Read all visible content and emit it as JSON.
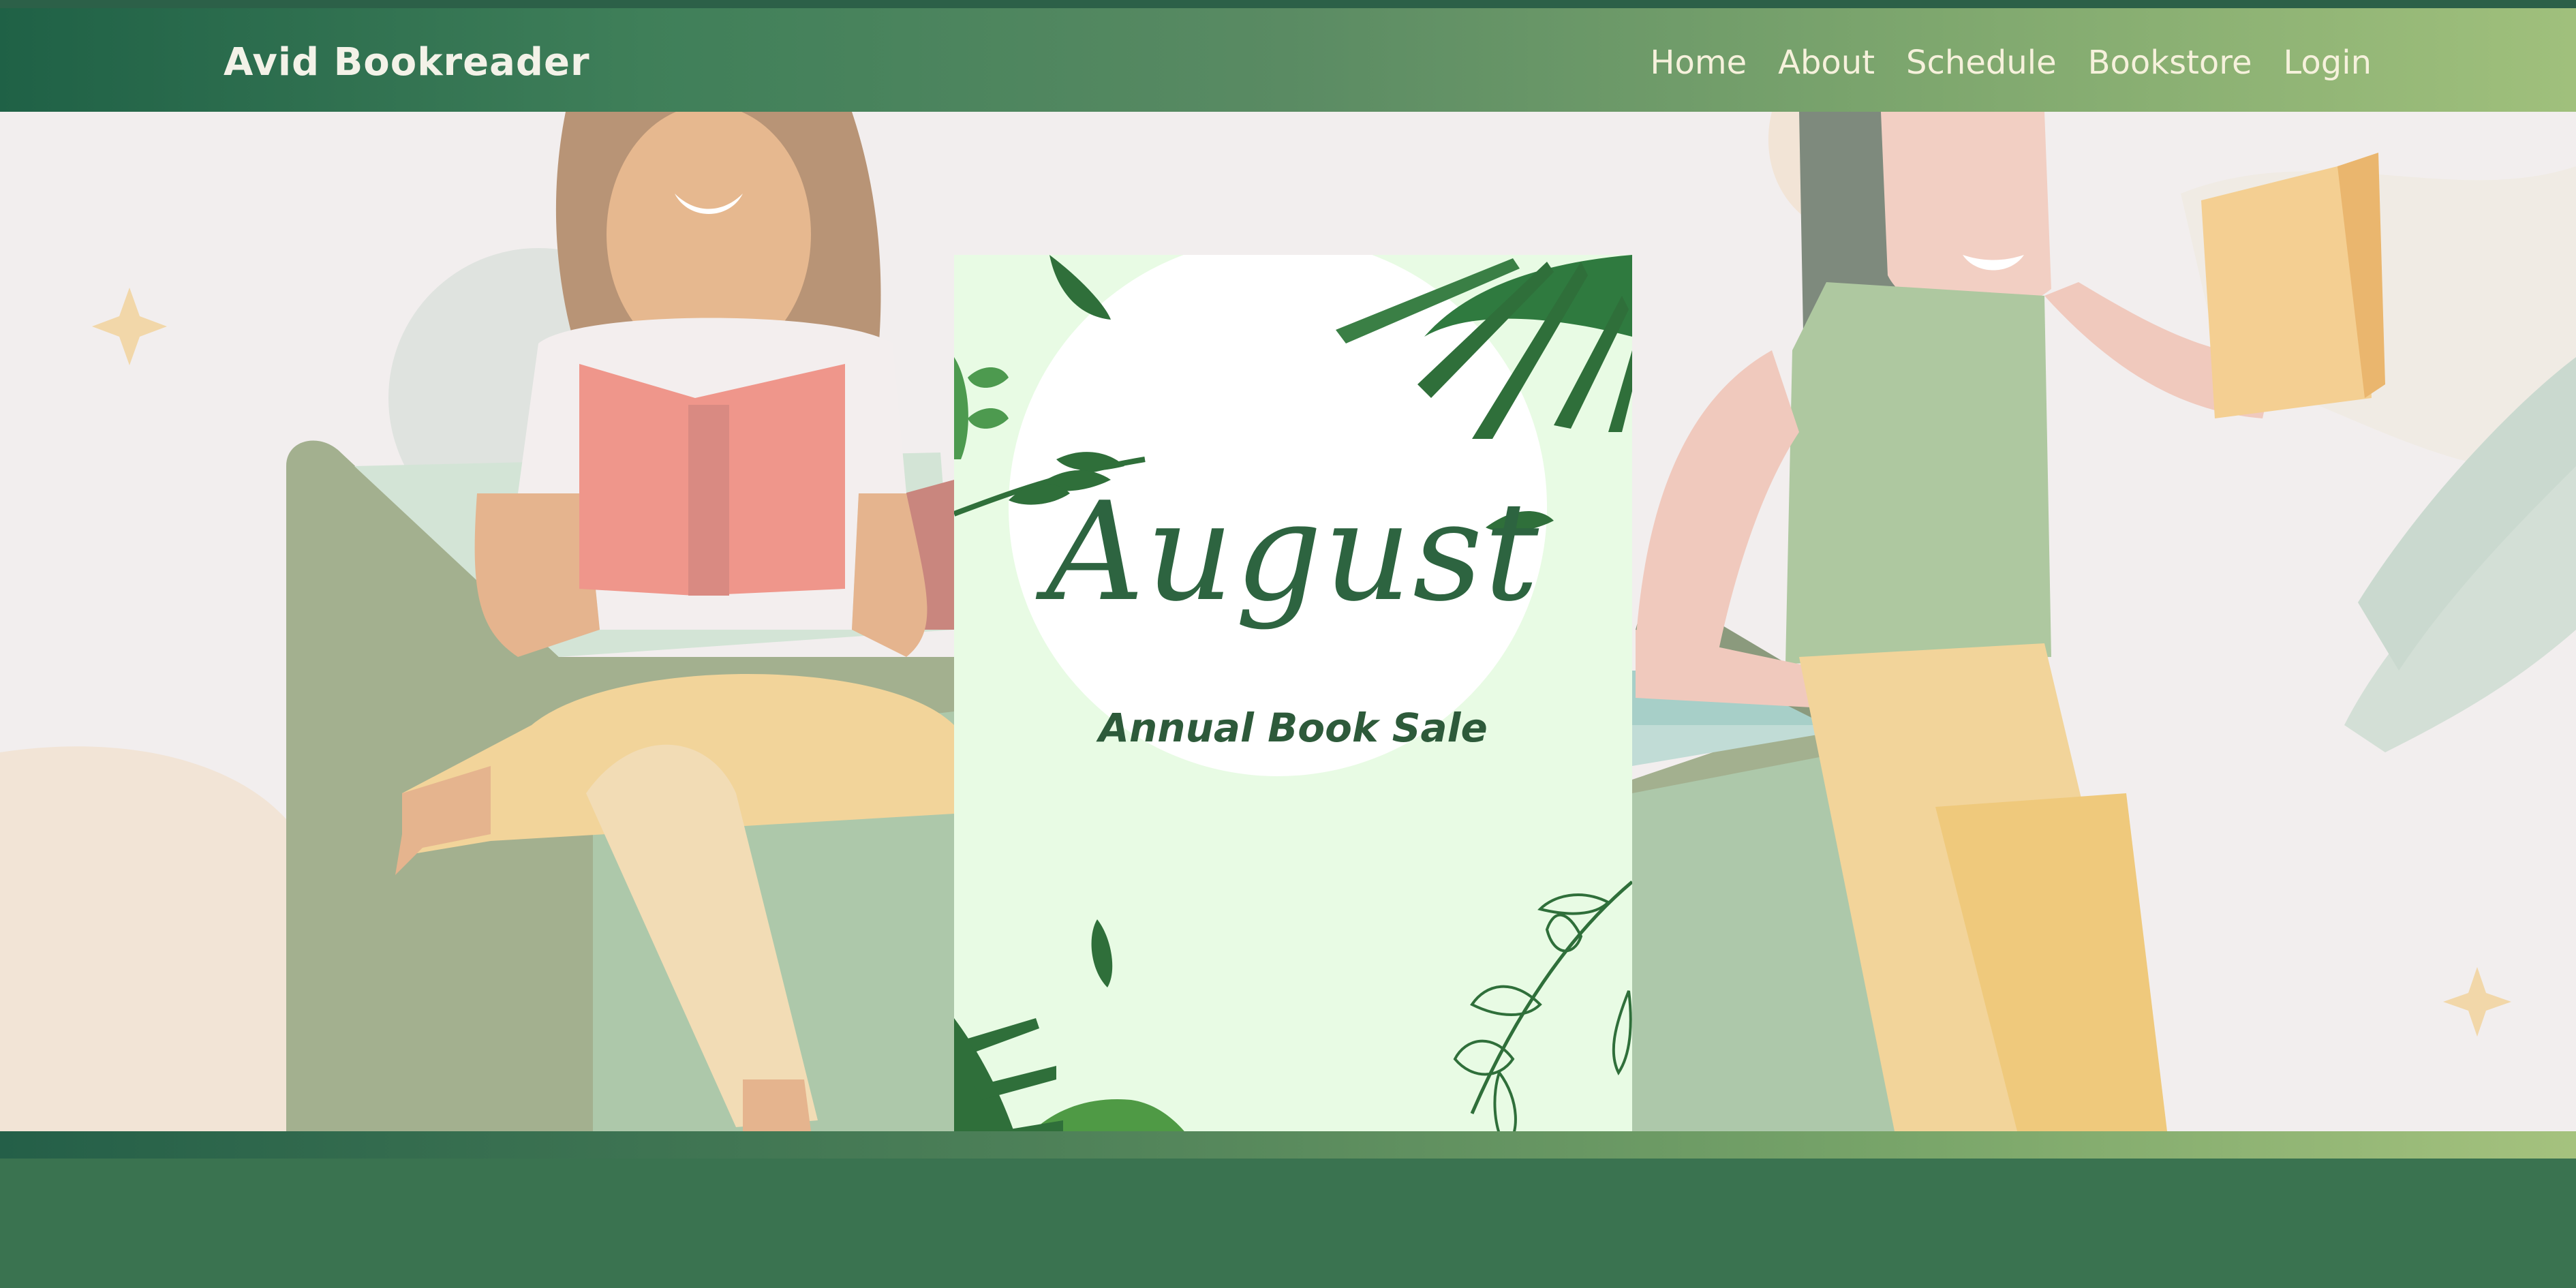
{
  "header": {
    "brand": "Avid Bookreader",
    "nav": [
      "Home",
      "About",
      "Schedule",
      "Bookstore",
      "Login"
    ]
  },
  "poster": {
    "title": "August",
    "subtitle": "Annual Book Sale"
  },
  "colors": {
    "header_start": "#1f6146",
    "header_end": "#a0c07c",
    "footer": "#3a7350",
    "hero_background": "#f2eeee",
    "poster_background": "#e8fbe4",
    "poster_text": "#2d6440"
  },
  "images": {
    "hero": "two-women-reading-illustration",
    "poster_decor": "tropical-leaves"
  }
}
